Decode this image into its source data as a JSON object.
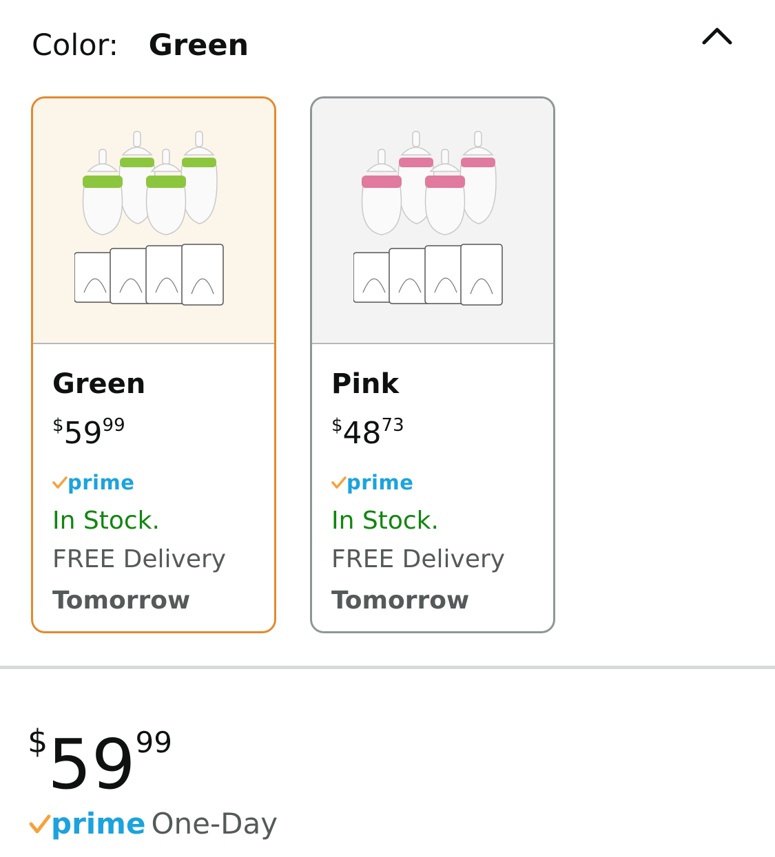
{
  "color_selector": {
    "label": "Color:",
    "selected_value": "Green",
    "collapse_icon": "chevron-up-icon"
  },
  "swatches": [
    {
      "name": "Green",
      "price_symbol": "$",
      "price_whole": "59",
      "price_fraction": "99",
      "prime_label": "prime",
      "stock": "In Stock.",
      "delivery": "FREE Delivery",
      "delivery_day": "Tomorrow",
      "accent_color": "#8cc63f",
      "selected": true
    },
    {
      "name": "Pink",
      "price_symbol": "$",
      "price_whole": "48",
      "price_fraction": "73",
      "prime_label": "prime",
      "stock": "In Stock.",
      "delivery": "FREE Delivery",
      "delivery_day": "Tomorrow",
      "accent_color": "#e07a9f",
      "selected": false
    }
  ],
  "price_block": {
    "symbol": "$",
    "whole": "59",
    "fraction": "99",
    "prime_label": "prime",
    "shipping": "One-Day"
  },
  "colors": {
    "selected_border": "#e3892e",
    "unselected_border": "#8f9696",
    "prime_blue": "#1ca3dd",
    "prime_check": "#f7a13a",
    "in_stock": "#11860e",
    "muted_text": "#565959"
  }
}
